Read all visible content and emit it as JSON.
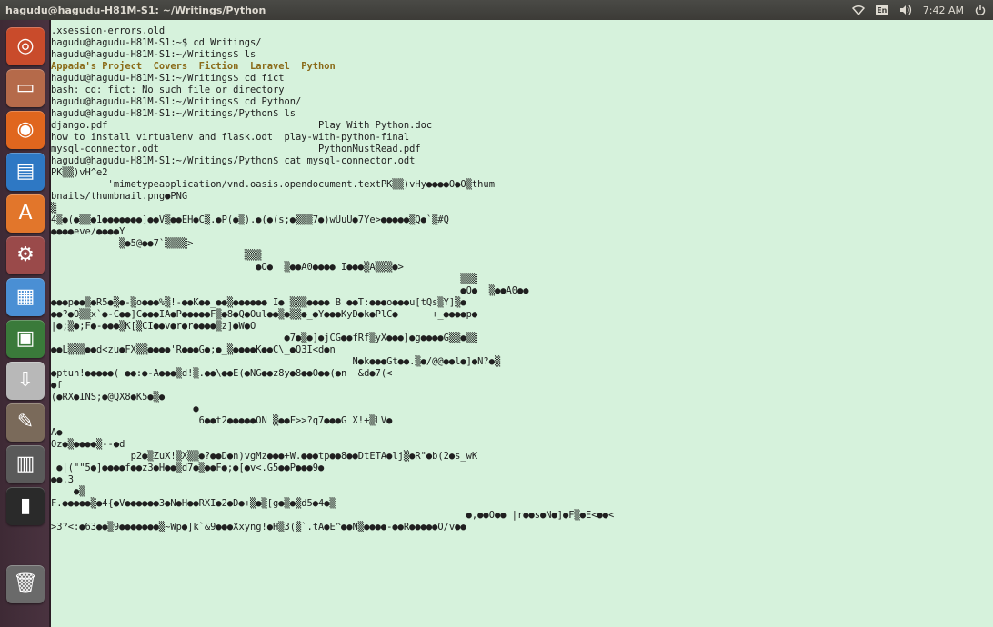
{
  "window": {
    "title": "hagudu@hagudu-H81M-S1: ~/Writings/Python"
  },
  "tray": {
    "network_icon": "wifi-icon",
    "keyboard_label": "En",
    "sound_icon": "volume-icon",
    "clock": "7:42 AM",
    "session_icon": "power-icon"
  },
  "launcher": {
    "items": [
      {
        "name": "dash",
        "icon": "ubuntu-logo-icon",
        "glyph": "◎",
        "bg": "#c94b2b"
      },
      {
        "name": "files",
        "icon": "folder-icon",
        "glyph": "▭",
        "bg": "#b56a4a"
      },
      {
        "name": "firefox",
        "icon": "firefox-icon",
        "glyph": "◉",
        "bg": "#e0661e"
      },
      {
        "name": "writer",
        "icon": "document-icon",
        "glyph": "▤",
        "bg": "#2e78c4"
      },
      {
        "name": "software-center",
        "icon": "shopping-bag-icon",
        "glyph": "A",
        "bg": "#e2762b"
      },
      {
        "name": "settings",
        "icon": "gear-icon",
        "glyph": "⚙",
        "bg": "#9a4a4a"
      },
      {
        "name": "impress",
        "icon": "presentation-icon",
        "glyph": "▦",
        "bg": "#4a8fd4"
      },
      {
        "name": "monitor",
        "icon": "system-monitor-icon",
        "glyph": "▣",
        "bg": "#3a7a3a"
      },
      {
        "name": "installer",
        "icon": "download-icon",
        "glyph": "⇩",
        "bg": "#b8b8b8"
      },
      {
        "name": "gimp",
        "icon": "paint-icon",
        "glyph": "✎",
        "bg": "#7a6a5a"
      },
      {
        "name": "video-editor",
        "icon": "clapperboard-icon",
        "glyph": "▥",
        "bg": "#5a5a5a"
      },
      {
        "name": "terminal",
        "icon": "terminal-icon",
        "glyph": "▮",
        "bg": "#2a2a2a"
      },
      {
        "name": "trash",
        "icon": "trash-icon",
        "glyph": "🗑",
        "bg": "#6a6a6a"
      }
    ]
  },
  "terminal": {
    "lines": [
      ".xsession-errors.old",
      "hagudu@hagudu-H81M-S1:~$ cd Writings/",
      "hagudu@hagudu-H81M-S1:~/Writings$ ls",
      "hagudu@hagudu-H81M-S1:~/Writings$ cd fict",
      "bash: cd: fict: No such file or directory",
      "hagudu@hagudu-H81M-S1:~/Writings$ cd Python/",
      "hagudu@hagudu-H81M-S1:~/Writings/Python$ ls",
      "django.pdf                                     Play With Python.doc",
      "how to install virtualenv and flask.odt  play-with-python-final",
      "mysql-connector.odt                            PythonMustRead.pdf",
      "hagudu@hagudu-H81M-S1:~/Writings/Python$ cat mysql-connector.odt",
      "PK▒▒)vH^e2",
      "          'mimetypeapplication/vnd.oasis.opendocument.textPK▒▒)vHy●●●●O●O▒thum",
      "bnails/thumbnail.png●PNG",
      "▒",
      "4▒●(●▒▒●1●●●●●●●]●●V▒●●EH●C▒.●P(●▒).●(●(s;●▒▒▒7●)wUuU●7Ye>●●●●●▒Q●`▒#Q",
      "●●●●eve/●●●●Y",
      "            ▒●5@●●7`▒▒▒▒>",
      "                                  ▒▒▒",
      "                                    ●O●  ▒●●A0●●●● I●●●▒A▒▒▒●>",
      "                                                                        ▒▒▒",
      "                                                                        ●O●  ▒●●A0●●",
      "●●●p●●▒●R5●▒●-▒o●●●%▒!-●●K●●_●●▒●●●●●● I● ▒▒▒●●●● B ●●T:●●●o●●●u[tQs▒Y]▒●",
      "●●?●O▒▒x`●-C●●]C●●●IA●P●●●●●F▒●8●Q●Oul●●▒●▒▒●_●Y●●●KyD●k●PlC●      +_●●●●p●",
      "|●;▒●;F●-●●●▒K[▒CI●●v●r●r●●●●▒z]●W●O",
      "                                         ●7●▒●]●jCG●●fRf▒yX●●●]●g●●●●G▒▒●▒▒",
      "●●L▒▒▒●●d<zu●FX▒▒●●●●'R●●●G●;●_▒●●●●K●●C\\_●Q3I<d●n",
      "                                                     N●k●●●Gt●●.▒●/@@●●l●]●N?●▒",
      "●ptun!●●●●●( ●●:●-A●●●▒d!▒.●●\\●●E(●NG●●z8y●8●●O●●(●n  &d●7(<",
      "●f",
      "(●RX●INS;●@QX8●K5●▒●",
      "                         ●",
      "                          6●●t2●●●●●ON ▒●●F>>?q7●●●G X!+▒LV●",
      "A●",
      "Oz●▒●●●●▒--●d",
      "              p2●▒ZuX!▒X▒▒●?●●D●n)vgMz●●●+W.●●●tp●●8●●DtETA●lj▒●R\"●b(2●s_wK",
      " ●|(\"\"5●]●●●●f●●z3●H●●▒d7●▒●●F●;●[●v<.G5●●P●●●9●",
      "●●.3",
      "    ●▒",
      "F.●●●●●▒●4{●V●●●●●●3●N●H●●RXI●2●D●+▒●▒[g●▒●▒d5●4●▒",
      "                                                                         ●,●●O●● |r●●s●N●]●F▒●E<●●<",
      ">3?<:●63●●▒9●●●●●●●▒~Wp●]k`&9●●●Xxyng!●H▒3(▒`.tA●E^●●N▒●●●●-●●R●●●●●O/v●●"
    ],
    "ls_output": "Appada's Project  Covers  Fiction  Laravel  Python"
  }
}
